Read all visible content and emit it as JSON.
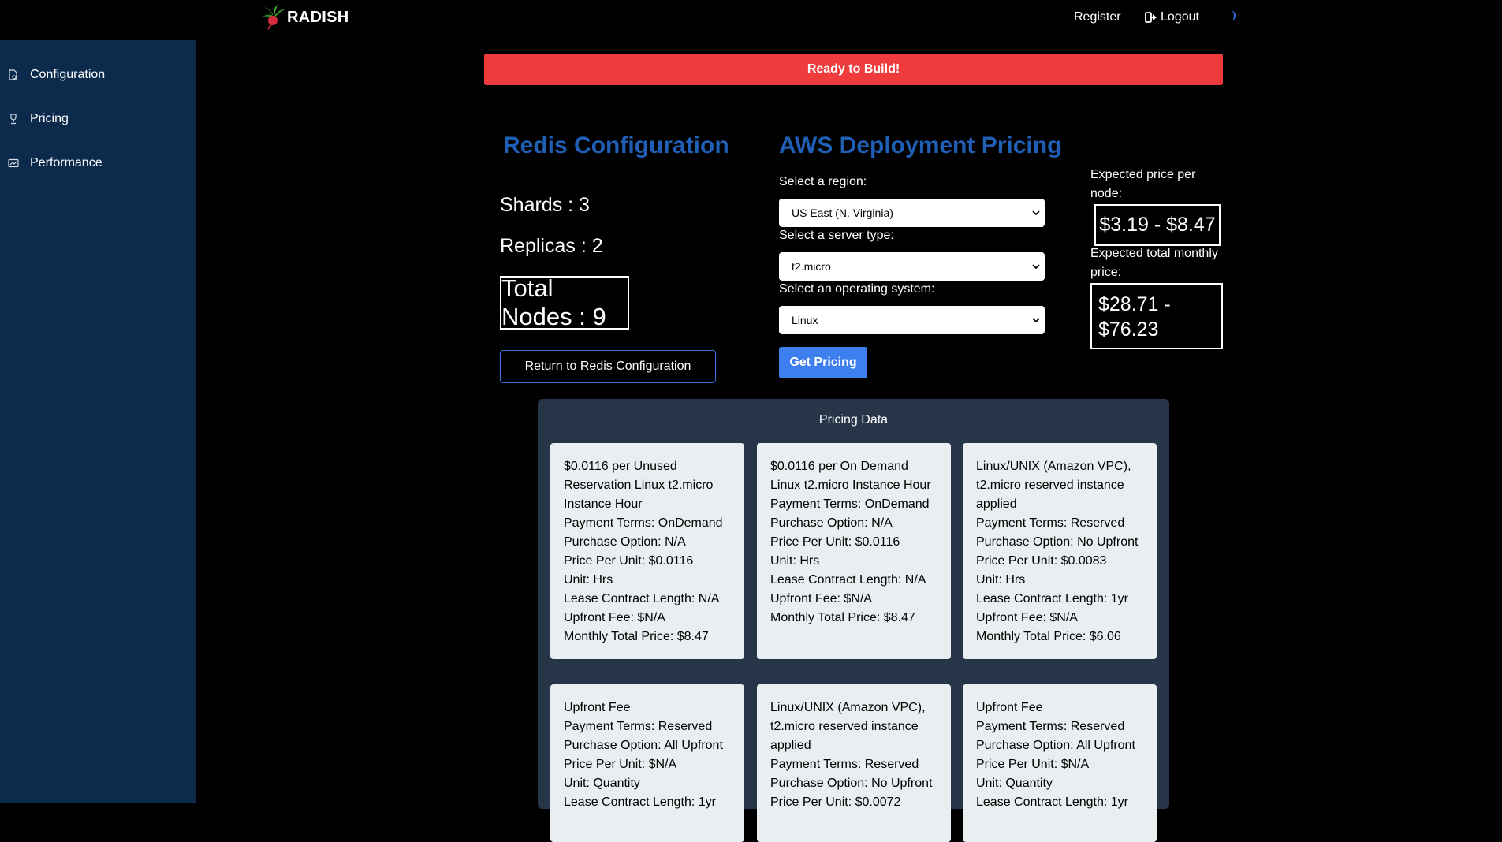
{
  "header": {
    "brand": "RADISH",
    "register": "Register",
    "logout": "Logout"
  },
  "sidebar": {
    "items": [
      {
        "label": "Configuration",
        "icon": "document-gear-icon"
      },
      {
        "label": "Pricing",
        "icon": "trophy-icon"
      },
      {
        "label": "Performance",
        "icon": "chart-card-icon"
      }
    ]
  },
  "banner": "Ready to Build!",
  "config": {
    "title": "Redis Configuration",
    "shards": "Shards : 3",
    "replicas": "Replicas : 2",
    "total_nodes": "Total Nodes : 9",
    "return_button": "Return to Redis Configuration"
  },
  "pricing": {
    "title": "AWS Deployment Pricing",
    "region_label": "Select a region:",
    "region_value": "US East (N. Virginia)",
    "server_label": "Select a server type:",
    "server_value": "t2.micro",
    "os_label": "Select an operating system:",
    "os_value": "Linux",
    "get_button": "Get Pricing",
    "per_node_label": "Expected price per node:",
    "per_node_value": "$3.19 - $8.47",
    "monthly_label": "Expected total monthly price:",
    "monthly_value": "$28.71 - $76.23"
  },
  "pricing_data": {
    "title": "Pricing Data",
    "cards": [
      {
        "lines": [
          "$0.0116 per Unused Reservation Linux t2.micro Instance Hour",
          "Payment Terms: OnDemand",
          "Purchase Option: N/A",
          "Price Per Unit: $0.0116",
          "Unit: Hrs",
          "Lease Contract Length: N/A",
          "Upfront Fee: $N/A",
          "Monthly Total Price: $8.47"
        ]
      },
      {
        "lines": [
          "$0.0116 per On Demand Linux t2.micro Instance Hour",
          "Payment Terms: OnDemand",
          "Purchase Option: N/A",
          "Price Per Unit: $0.0116",
          "Unit: Hrs",
          "Lease Contract Length: N/A",
          "Upfront Fee: $N/A",
          "Monthly Total Price: $8.47"
        ]
      },
      {
        "lines": [
          "Linux/UNIX (Amazon VPC), t2.micro reserved instance applied",
          "Payment Terms: Reserved",
          "Purchase Option: No Upfront",
          "Price Per Unit: $0.0083",
          "Unit: Hrs",
          "Lease Contract Length: 1yr",
          "Upfront Fee: $N/A",
          "Monthly Total Price: $6.06"
        ]
      },
      {
        "lines": [
          "Upfront Fee",
          "Payment Terms: Reserved",
          "Purchase Option: All Upfront",
          "Price Per Unit: $N/A",
          "Unit: Quantity",
          "Lease Contract Length: 1yr"
        ]
      },
      {
        "lines": [
          "Linux/UNIX (Amazon VPC), t2.micro reserved instance applied",
          "Payment Terms: Reserved",
          "Purchase Option: No Upfront",
          "Price Per Unit: $0.0072"
        ]
      },
      {
        "lines": [
          "Upfront Fee",
          "Payment Terms: Reserved",
          "Purchase Option: All Upfront",
          "Price Per Unit: $N/A",
          "Unit: Quantity",
          "Lease Contract Length: 1yr"
        ]
      }
    ]
  },
  "colors": {
    "sidebar": "#0b2a4c",
    "banner": "#ef3b3b",
    "heading": "#1f5fb5",
    "primary_button": "#3d7fef",
    "panel": "#263548",
    "card": "#e9eef0"
  }
}
